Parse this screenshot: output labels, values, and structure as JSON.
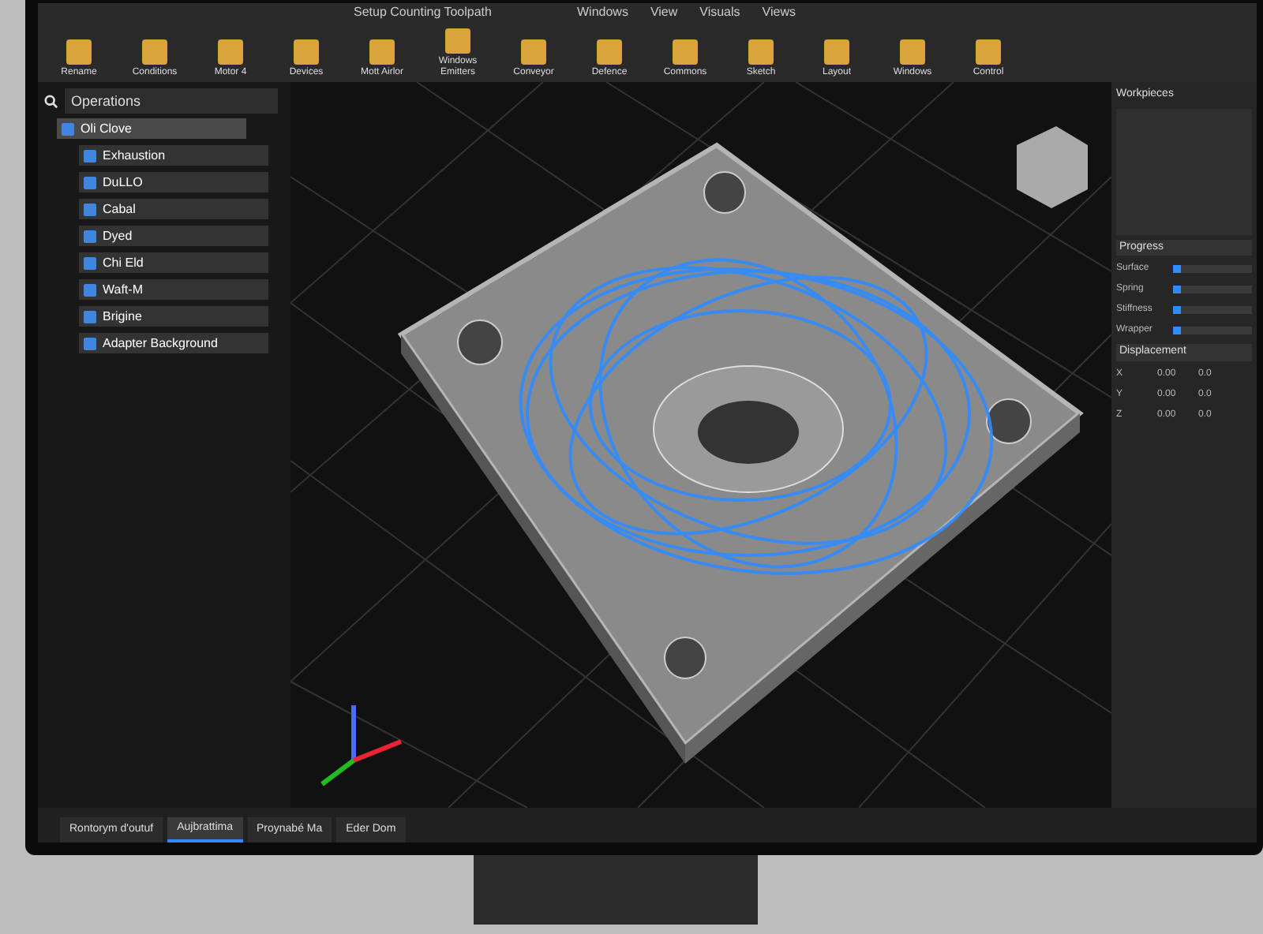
{
  "window": {
    "title": "Setup Counting Toolpath"
  },
  "menu": [
    "Windows",
    "View",
    "Visuals",
    "Views"
  ],
  "toolbar": [
    {
      "label": "Rename"
    },
    {
      "label": "Conditions"
    },
    {
      "label": "Motor 4"
    },
    {
      "label": "Devices"
    },
    {
      "label": "Mott Airlor"
    },
    {
      "label": "Windows Emitters"
    },
    {
      "label": "Conveyor"
    },
    {
      "label": "Defence"
    },
    {
      "label": "Commons"
    },
    {
      "label": "Sketch"
    },
    {
      "label": "Layout"
    },
    {
      "label": "Windows"
    },
    {
      "label": "Control"
    }
  ],
  "search": {
    "placeholder": "Operations"
  },
  "tree": {
    "label": "Oli Clove",
    "selected": true,
    "children": [
      {
        "label": "Exhaustion",
        "selected": false
      },
      {
        "label": "DuLLO",
        "selected": false
      },
      {
        "label": "Cabal",
        "selected": false
      },
      {
        "label": "Dyed",
        "selected": false
      },
      {
        "label": "Chi Eld",
        "selected": false
      },
      {
        "label": "Waft-M",
        "selected": false
      },
      {
        "label": "Brigine",
        "selected": false
      },
      {
        "label": "Adapter Background",
        "selected": false
      }
    ]
  },
  "right_panel": {
    "title": "Workpieces",
    "sections": [
      {
        "title": "Progress",
        "sliders": [
          {
            "label": "Surface",
            "level": 0.1
          },
          {
            "label": "Spring",
            "level": 0.1
          },
          {
            "label": "Stiffness",
            "level": 0.1
          },
          {
            "label": "Wrapper",
            "level": 0.1
          }
        ]
      },
      {
        "title": "Displacement",
        "rows": [
          [
            "X",
            "0.00",
            "0.0"
          ],
          [
            "Y",
            "0.00",
            "0.0"
          ],
          [
            "Z",
            "0.00",
            "0.0"
          ]
        ]
      }
    ]
  },
  "tabs": [
    {
      "label": "Rontorym d'outuf",
      "selected": false
    },
    {
      "label": "Aujbrattima",
      "selected": true
    },
    {
      "label": "Proynabé Ma",
      "selected": false
    },
    {
      "label": "Eder Dom",
      "selected": false
    }
  ]
}
